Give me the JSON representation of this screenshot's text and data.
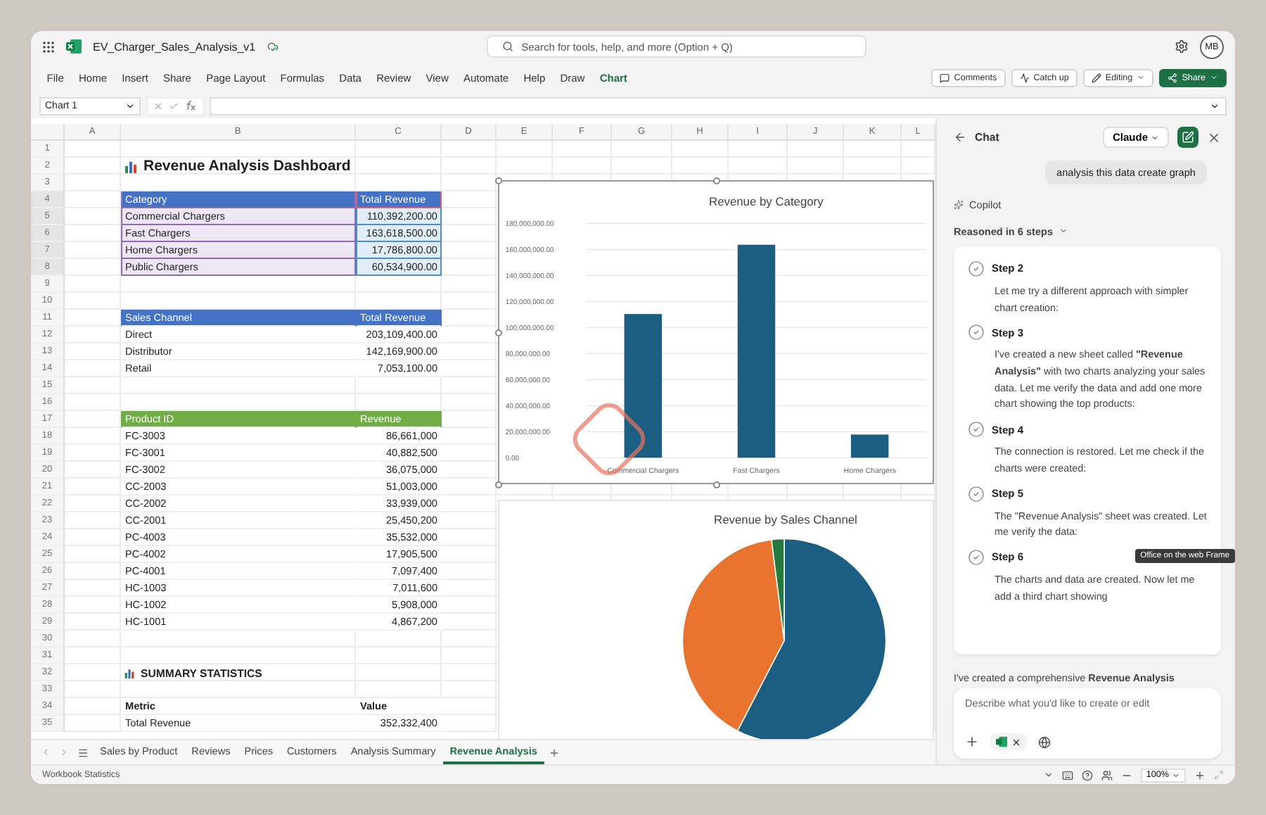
{
  "title_bar": {
    "file_name": "EV_Charger_Sales_Analysis_v1",
    "search": {
      "placeholder": "Search for tools, help, and more (Option + Q)"
    },
    "avatar": "MB"
  },
  "ribbon": {
    "tabs": [
      {
        "label": "File",
        "selected": false
      },
      {
        "label": "Home",
        "selected": false
      },
      {
        "label": "Insert",
        "selected": false
      },
      {
        "label": "Share",
        "selected": false
      },
      {
        "label": "Page Layout",
        "selected": false
      },
      {
        "label": "Formulas",
        "selected": false
      },
      {
        "label": "Data",
        "selected": false
      },
      {
        "label": "Review",
        "selected": false
      },
      {
        "label": "View",
        "selected": false
      },
      {
        "label": "Automate",
        "selected": false
      },
      {
        "label": "Help",
        "selected": false
      },
      {
        "label": "Draw",
        "selected": false
      },
      {
        "label": "Chart",
        "selected": true
      }
    ],
    "buttons": [
      {
        "label": "Comments",
        "kind": "comments"
      },
      {
        "label": "Catch up",
        "kind": "catchup"
      },
      {
        "label": "Editing",
        "kind": "editing"
      },
      {
        "label": "Share",
        "kind": "share"
      }
    ]
  },
  "formula_bar": {
    "name_box": "Chart 1"
  },
  "sheet": {
    "columns": [
      "A",
      "B",
      "C",
      "D",
      "E",
      "F",
      "G",
      "H",
      "I",
      "J",
      "K",
      "L"
    ],
    "rows": [
      {
        "number": "1",
        "kind": "blank",
        "highlighted": false
      },
      {
        "number": "2",
        "kind": "title",
        "text": "Revenue Analysis Dashboard",
        "highlighted": false
      },
      {
        "number": "3",
        "kind": "blank",
        "highlighted": false
      },
      {
        "number": "4",
        "kind": "header",
        "color": "#4472c4",
        "cells": [
          "Category",
          "Total Revenue"
        ],
        "highlighted": true
      },
      {
        "number": "5",
        "kind": "data",
        "cells": [
          "Commercial Chargers",
          "110,392,200.00"
        ],
        "highlighted": true
      },
      {
        "number": "6",
        "kind": "data",
        "cells": [
          "Fast Chargers",
          "163,618,500.00"
        ],
        "highlighted": true
      },
      {
        "number": "7",
        "kind": "data",
        "cells": [
          "Home Chargers",
          "17,786,800.00"
        ],
        "highlighted": true
      },
      {
        "number": "8",
        "kind": "data",
        "cells": [
          "Public Chargers",
          "60,534,900.00"
        ],
        "highlighted": true
      },
      {
        "number": "9",
        "kind": "blank",
        "highlighted": false
      },
      {
        "number": "10",
        "kind": "blank",
        "highlighted": false
      },
      {
        "number": "11",
        "kind": "header",
        "color": "#4472c4",
        "cells": [
          "Sales Channel",
          "Total Revenue"
        ],
        "highlighted": false
      },
      {
        "number": "12",
        "kind": "data",
        "cells": [
          "Direct",
          "203,109,400.00"
        ],
        "highlighted": false
      },
      {
        "number": "13",
        "kind": "data",
        "cells": [
          "Distributor",
          "142,169,900.00"
        ],
        "highlighted": false
      },
      {
        "number": "14",
        "kind": "data",
        "cells": [
          "Retail",
          "7,053,100.00"
        ],
        "highlighted": false
      },
      {
        "number": "15",
        "kind": "blank",
        "highlighted": false
      },
      {
        "number": "16",
        "kind": "blank",
        "highlighted": false
      },
      {
        "number": "17",
        "kind": "header",
        "color": "#70ad47",
        "cells": [
          "Product ID",
          "Revenue"
        ],
        "highlighted": false
      },
      {
        "number": "18",
        "kind": "data",
        "cells": [
          "FC-3003",
          "86,661,000"
        ],
        "highlighted": false
      },
      {
        "number": "19",
        "kind": "data",
        "cells": [
          "FC-3001",
          "40,882,500"
        ],
        "highlighted": false
      },
      {
        "number": "20",
        "kind": "data",
        "cells": [
          "FC-3002",
          "36,075,000"
        ],
        "highlighted": false
      },
      {
        "number": "21",
        "kind": "data",
        "cells": [
          "CC-2003",
          "51,003,000"
        ],
        "highlighted": false
      },
      {
        "number": "22",
        "kind": "data",
        "cells": [
          "CC-2002",
          "33,939,000"
        ],
        "highlighted": false
      },
      {
        "number": "23",
        "kind": "data",
        "cells": [
          "CC-2001",
          "25,450,200"
        ],
        "highlighted": false
      },
      {
        "number": "24",
        "kind": "data",
        "cells": [
          "PC-4003",
          "35,532,000"
        ],
        "highlighted": false
      },
      {
        "number": "25",
        "kind": "data",
        "cells": [
          "PC-4002",
          "17,905,500"
        ],
        "highlighted": false
      },
      {
        "number": "26",
        "kind": "data",
        "cells": [
          "PC-4001",
          "7,097,400"
        ],
        "highlighted": false
      },
      {
        "number": "27",
        "kind": "data",
        "cells": [
          "HC-1003",
          "7,011,600"
        ],
        "highlighted": false
      },
      {
        "number": "28",
        "kind": "data",
        "cells": [
          "HC-1002",
          "5,908,000"
        ],
        "highlighted": false
      },
      {
        "number": "29",
        "kind": "data",
        "cells": [
          "HC-1001",
          "4,867,200"
        ],
        "highlighted": false
      },
      {
        "number": "30",
        "kind": "blank",
        "highlighted": false
      },
      {
        "number": "31",
        "kind": "blank",
        "highlighted": false
      },
      {
        "number": "32",
        "kind": "section",
        "text": "SUMMARY STATISTICS",
        "highlighted": false
      },
      {
        "number": "33",
        "kind": "blank",
        "highlighted": false
      },
      {
        "number": "34",
        "kind": "label",
        "cells": [
          "Metric",
          "Value"
        ],
        "highlighted": false
      },
      {
        "number": "35",
        "kind": "data",
        "cells": [
          "Total Revenue",
          "352,332,400"
        ],
        "highlighted": false
      }
    ],
    "bar_chart": {
      "chart_data": {
        "type": "bar",
        "title": "Revenue by Category",
        "grid": true,
        "categories": [
          "Commercial Chargers",
          "Fast Chargers",
          "Home Chargers"
        ],
        "series": [
          {
            "color": "#1b5e82",
            "values": [
              110392200,
              163618500,
              17786800
            ]
          }
        ],
        "ylim": [
          0,
          180000000
        ],
        "yticks": [
          {
            "value": 0,
            "label": "0.00"
          },
          {
            "value": 20000000,
            "label": "20,000,000.00"
          },
          {
            "value": 40000000,
            "label": "40,000,000.00"
          },
          {
            "value": 60000000,
            "label": "60,000,000.00"
          },
          {
            "value": 80000000,
            "label": "80,000,000.00"
          },
          {
            "value": 100000000,
            "label": "100,000,000.00"
          },
          {
            "value": 120000000,
            "label": "120,000,000.00"
          },
          {
            "value": 140000000,
            "label": "140,000,000.00"
          },
          {
            "value": 160000000,
            "label": "160,000,000.00"
          },
          {
            "value": 180000000,
            "label": "180,000,000.00"
          }
        ]
      }
    },
    "pie_chart": {
      "chart_data": {
        "type": "pie",
        "title": "Revenue by Sales Channel",
        "series": [
          {
            "values": [
              57.6,
              40.4,
              2.0
            ]
          }
        ],
        "colors": [
          "#1b5e82",
          "#e8742f",
          "#237a3b"
        ]
      }
    }
  },
  "sheet_tabs": [
    {
      "label": "Sales by Product",
      "selected": false
    },
    {
      "label": "Reviews",
      "selected": false
    },
    {
      "label": "Prices",
      "selected": false
    },
    {
      "label": "Customers",
      "selected": false
    },
    {
      "label": "Analysis Summary",
      "selected": false
    },
    {
      "label": "Revenue Analysis",
      "selected": true
    }
  ],
  "status_bar": {
    "text": "Workbook Statistics",
    "zoom": "100%"
  },
  "chat": {
    "title": "Chat",
    "model": "Claude",
    "user_message": "analysis this data create graph",
    "assistant": "Copilot",
    "reasoning": "Reasoned in 6 steps",
    "steps": [
      {
        "title": "Step 2",
        "text": "Let me try a different approach with simpler chart creation:"
      },
      {
        "title": "Step 3",
        "text": "I've created a new sheet called **\"Revenue Analysis\"** with two charts analyzing your sales data. Let me verify the data and add one more chart showing the top products:"
      },
      {
        "title": "Step 4",
        "text": "The connection is restored. Let me check if the charts were created:"
      },
      {
        "title": "Step 5",
        "text": "The \"Revenue Analysis\" sheet was created. Let me verify the data:"
      },
      {
        "title": "Step 6",
        "text": "The charts and data are created. Now let me add a third chart showing"
      }
    ],
    "reply": "I've created a comprehensive **Revenue Analysis**",
    "input": {
      "placeholder": "Describe what you'd like to create or edit"
    },
    "tooltip": "Office on the web Frame"
  }
}
